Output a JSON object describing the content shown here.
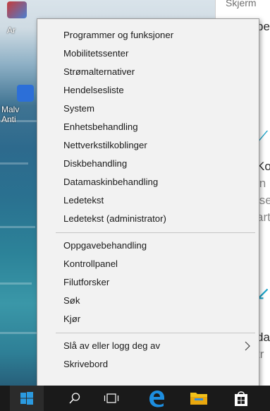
{
  "desktop": {
    "icons": [
      {
        "label": "Ar"
      },
      {
        "label": "Malv"
      },
      {
        "label": "Anti"
      }
    ],
    "right_window": {
      "title_fragment": "Skjerm",
      "fragments": [
        "pe",
        "Ko",
        "in",
        "ise",
        "art",
        "da",
        "tr"
      ]
    }
  },
  "menu": {
    "groups": [
      {
        "items": [
          {
            "label": "Programmer og funksjoner"
          },
          {
            "label": "Mobilitetssenter"
          },
          {
            "label": "Strømalternativer"
          },
          {
            "label": "Hendelsesliste"
          },
          {
            "label": "System"
          },
          {
            "label": "Enhetsbehandling"
          },
          {
            "label": "Nettverkstilkoblinger"
          },
          {
            "label": "Diskbehandling"
          },
          {
            "label": "Datamaskinbehandling"
          },
          {
            "label": "Ledetekst"
          },
          {
            "label": "Ledetekst (administrator)"
          }
        ]
      },
      {
        "items": [
          {
            "label": "Oppgavebehandling"
          },
          {
            "label": "Kontrollpanel"
          },
          {
            "label": "Filutforsker"
          },
          {
            "label": "Søk"
          },
          {
            "label": "Kjør"
          }
        ]
      },
      {
        "items": [
          {
            "label": "Slå av eller logg deg av",
            "has_submenu": true,
            "submenu_icon": "chevron-right-icon"
          },
          {
            "label": "Skrivebord"
          }
        ]
      }
    ]
  },
  "taskbar": {
    "items": [
      {
        "icon": "windows-start-icon"
      },
      {
        "icon": "search-icon"
      },
      {
        "icon": "task-view-icon"
      },
      {
        "icon": "edge-browser-icon"
      },
      {
        "icon": "file-explorer-icon"
      },
      {
        "icon": "store-icon"
      }
    ],
    "colors": {
      "start": "#2b9ae0",
      "edge": "#1d8ee0",
      "explorer": "#f2c21b",
      "background": "#1a1a1a"
    }
  }
}
